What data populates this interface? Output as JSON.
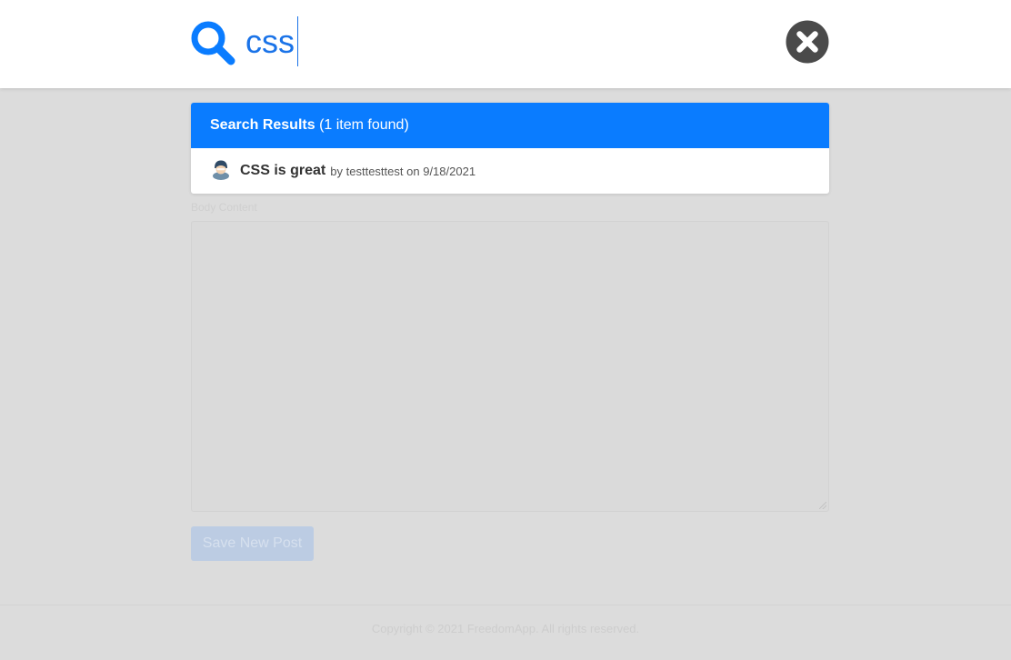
{
  "search": {
    "query": "css"
  },
  "results": {
    "header_bold": "Search Results",
    "header_count": "(1 item found)",
    "items": [
      {
        "title": "CSS is great",
        "by_prefix": "by",
        "author": "testtesttest",
        "date_prefix": "on",
        "date": "9/18/2021"
      }
    ]
  },
  "page": {
    "body_label": "Body Content",
    "save_button": "Save New Post",
    "footer": "Copyright © 2021 FreedomApp. All rights reserved."
  },
  "colors": {
    "accent": "#0a7cff",
    "overlay": "#dcdcdc",
    "close_icon": "#4a4a4a"
  },
  "icons": {
    "search": "search-icon",
    "close": "close-icon",
    "avatar": "avatar"
  }
}
